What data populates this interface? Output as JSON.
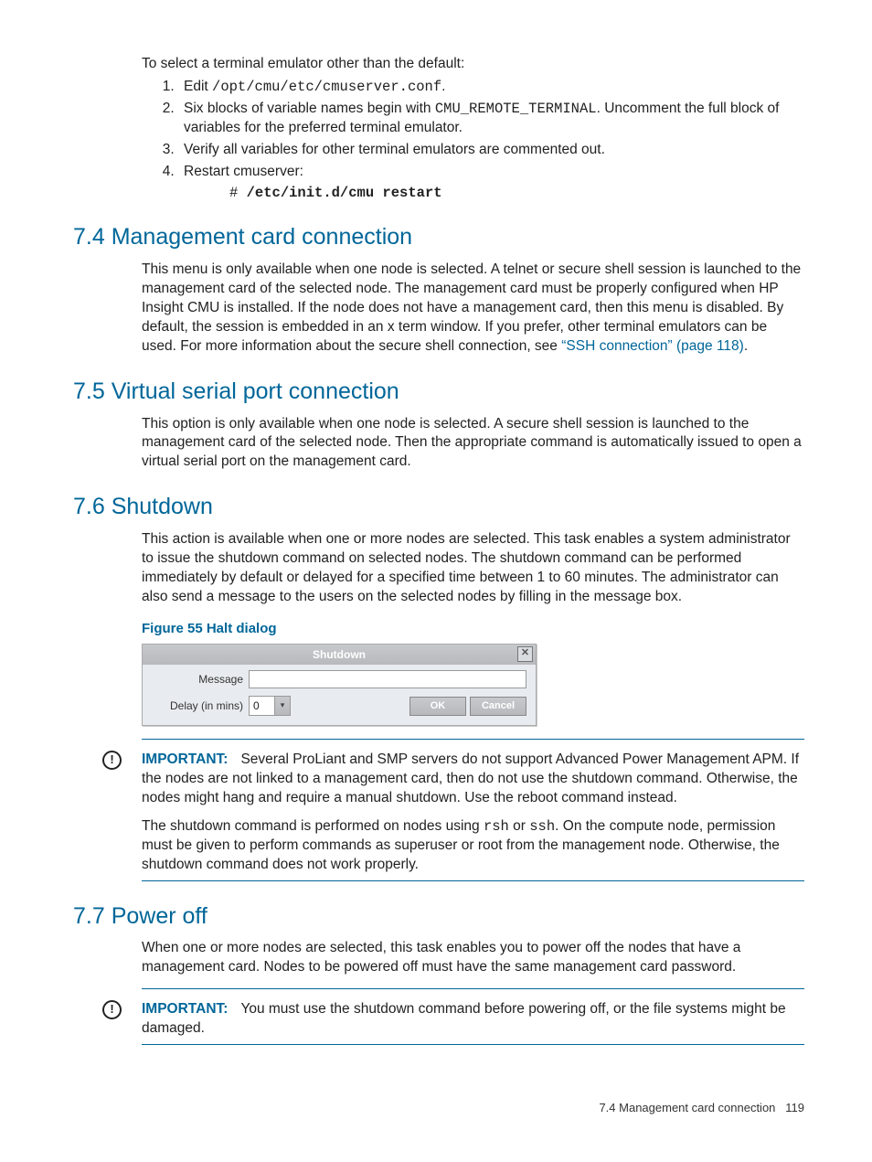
{
  "intro": {
    "lead": "To select a terminal emulator other than the default:",
    "item1_a": "Edit ",
    "item1_code": "/opt/cmu/etc/cmuserver.conf",
    "item1_b": ".",
    "item2_a": "Six blocks of variable names begin with ",
    "item2_code": "CMU_REMOTE_TERMINAL",
    "item2_b": ". Uncomment the full block of variables for the preferred terminal emulator.",
    "item3": "Verify all variables for other terminal emulators are commented out.",
    "item4": "Restart cmuserver:",
    "item4_cmd_hash": "# ",
    "item4_cmd": "/etc/init.d/cmu restart"
  },
  "s74": {
    "heading": "7.4 Management card connection",
    "body_a": "This menu is only available when one node is selected. A telnet or secure shell session is launched to the management card of the selected node. The management card must be properly configured when HP Insight CMU is installed. If the node does not have a management card, then this menu is disabled. By default, the session is embedded in an x term window. If you prefer, other terminal emulators can be used. For more information about the secure shell connection, see ",
    "link": "“SSH connection” (page 118)",
    "body_b": "."
  },
  "s75": {
    "heading": "7.5 Virtual serial port connection",
    "body": "This option is only available when one node is selected. A secure shell session is launched to the management card of the selected node. Then the appropriate command is automatically issued to open a virtual serial port on the management card."
  },
  "s76": {
    "heading": "7.6 Shutdown",
    "body": "This action is available when one or more nodes are selected. This task enables a system administrator to issue the shutdown command on selected nodes. The shutdown command can be performed immediately by default or delayed for a specified time between 1 to 60 minutes. The administrator can also send a message to the users on the selected nodes by filling in the message box.",
    "figcap": "Figure 55 Halt dialog",
    "dialog": {
      "title": "Shutdown",
      "message_label": "Message",
      "delay_label": "Delay (in mins)",
      "delay_value": "0",
      "ok": "OK",
      "cancel": "Cancel"
    },
    "important_label": "IMPORTANT:",
    "important_body": "Several ProLiant and SMP servers do not support Advanced Power Management APM. If the nodes are not linked to a management card, then do not use the shutdown command. Otherwise, the nodes might hang and require a manual shutdown. Use the reboot command instead.",
    "para2_a": "The shutdown command is performed on nodes using ",
    "para2_code1": "rsh",
    "para2_b": " or ",
    "para2_code2": "ssh",
    "para2_c": ". On the compute node, permission must be given to perform commands as superuser or root from the management node. Otherwise, the shutdown command does not work properly."
  },
  "s77": {
    "heading": "7.7 Power off",
    "body": "When one or more nodes are selected, this task enables you to power off the nodes that have a management card. Nodes to be powered off must have the same management card password.",
    "important_label": "IMPORTANT:",
    "important_body": "You must use the shutdown command before powering off, or the file systems might be damaged."
  },
  "footer": {
    "text": "7.4 Management card connection",
    "page": "119"
  }
}
